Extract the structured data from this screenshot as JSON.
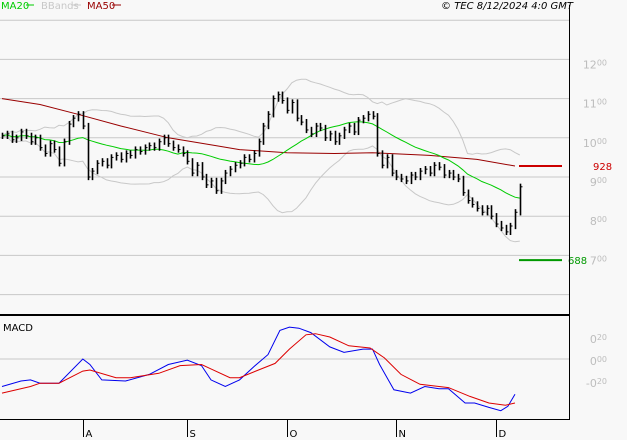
{
  "legend": {
    "ma20": "MA20",
    "bbands": "BBands",
    "ma50": "MA50",
    "copyright": "© TEC 8/12/2024 4:0 GMT"
  },
  "colors": {
    "ma20": "#00cc00",
    "bbands": "#c8c8c8",
    "ma50": "#990000",
    "bars": "#000000",
    "macd": "#0000ee",
    "signal": "#dd0000",
    "resistance": "#cc0000",
    "support": "#009900",
    "grid": "#c8c8c8"
  },
  "chart_data": [
    {
      "type": "ohlc-bar",
      "title": "",
      "ylim": [
        6,
        13
      ],
      "yticks": [
        {
          "value": 12,
          "int": "12",
          "dec": "00"
        },
        {
          "value": 11,
          "int": "11",
          "dec": "00"
        },
        {
          "value": 10,
          "int": "10",
          "dec": "00"
        },
        {
          "value": 9,
          "int": "9",
          "dec": "00"
        },
        {
          "value": 8,
          "int": "8",
          "dec": "00"
        },
        {
          "value": 7,
          "int": "7",
          "dec": "00"
        }
      ],
      "xticks": [
        {
          "index": 17,
          "label": "A"
        },
        {
          "index": 39,
          "label": "S"
        },
        {
          "index": 60,
          "label": "O"
        },
        {
          "index": 83,
          "label": "N"
        },
        {
          "index": 104,
          "label": "D"
        }
      ],
      "bar_pad": 0.08,
      "close": [
        10.05,
        10.1,
        9.95,
        10.0,
        10.15,
        10.05,
        9.9,
        10.0,
        9.75,
        9.6,
        9.85,
        9.7,
        9.35,
        9.9,
        10.35,
        10.5,
        10.6,
        10.3,
        9.0,
        9.15,
        9.35,
        9.4,
        9.3,
        9.5,
        9.55,
        9.45,
        9.6,
        9.55,
        9.7,
        9.65,
        9.75,
        9.8,
        9.75,
        9.9,
        10.0,
        9.85,
        9.75,
        9.7,
        9.6,
        9.4,
        9.1,
        9.3,
        9.0,
        8.8,
        8.9,
        8.65,
        8.9,
        9.1,
        9.2,
        9.3,
        9.35,
        9.5,
        9.45,
        9.6,
        9.9,
        10.3,
        10.6,
        11.0,
        11.1,
        10.95,
        10.7,
        10.9,
        10.5,
        10.4,
        10.2,
        10.1,
        10.3,
        10.25,
        10.0,
        10.1,
        9.9,
        10.05,
        10.2,
        10.3,
        10.15,
        10.45,
        10.5,
        10.6,
        10.55,
        9.6,
        9.3,
        9.5,
        9.1,
        9.0,
        8.95,
        8.9,
        9.05,
        9.0,
        9.15,
        9.2,
        9.1,
        9.3,
        9.25,
        9.05,
        9.1,
        9.0,
        8.95,
        8.6,
        8.4,
        8.3,
        8.2,
        8.1,
        8.2,
        8.0,
        7.8,
        7.7,
        7.6,
        7.75,
        8.1,
        8.75
      ],
      "ma20_period": 20,
      "bb_stddev": 2,
      "ma50_points": [
        [
          0,
          11.0
        ],
        [
          8,
          10.85
        ],
        [
          16,
          10.6
        ],
        [
          25,
          10.3
        ],
        [
          35,
          10.0
        ],
        [
          45,
          9.8
        ],
        [
          50,
          9.7
        ],
        [
          60,
          9.62
        ],
        [
          70,
          9.6
        ],
        [
          78,
          9.62
        ],
        [
          90,
          9.55
        ],
        [
          100,
          9.45
        ],
        [
          108,
          9.28
        ]
      ],
      "levels": [
        {
          "name": "resistance",
          "value": 9.28,
          "label": "928"
        },
        {
          "name": "support",
          "value": 6.88,
          "label": "688"
        }
      ]
    },
    {
      "type": "line",
      "title": "MACD",
      "ylim": [
        -0.55,
        0.4
      ],
      "yticks": [
        {
          "value": 0.2,
          "int": "0",
          "dec": "20"
        },
        {
          "value": 0.0,
          "int": "0",
          "dec": "00"
        },
        {
          "value": -0.2,
          "int": "-0",
          "dec": "20"
        }
      ],
      "series": [
        {
          "name": "MACD",
          "points": [
            [
              0,
              -0.25
            ],
            [
              4,
              -0.2
            ],
            [
              6,
              -0.19
            ],
            [
              8,
              -0.22
            ],
            [
              12,
              -0.22
            ],
            [
              17,
              0.0
            ],
            [
              18.5,
              -0.05
            ],
            [
              21,
              -0.19
            ],
            [
              26,
              -0.2
            ],
            [
              31,
              -0.14
            ],
            [
              35,
              -0.05
            ],
            [
              39,
              -0.01
            ],
            [
              42,
              -0.06
            ],
            [
              44,
              -0.19
            ],
            [
              47,
              -0.25
            ],
            [
              50,
              -0.19
            ],
            [
              53,
              -0.07
            ],
            [
              56,
              0.04
            ],
            [
              58.5,
              0.26
            ],
            [
              60.5,
              0.29
            ],
            [
              62.5,
              0.28
            ],
            [
              65,
              0.24
            ],
            [
              69,
              0.11
            ],
            [
              72,
              0.06
            ],
            [
              76,
              0.09
            ],
            [
              78,
              0.09
            ],
            [
              79.5,
              -0.05
            ],
            [
              82.5,
              -0.28
            ],
            [
              86,
              -0.31
            ],
            [
              89,
              -0.25
            ],
            [
              92,
              -0.27
            ],
            [
              94,
              -0.27
            ],
            [
              97.5,
              -0.4
            ],
            [
              99.5,
              -0.4
            ],
            [
              102.5,
              -0.44
            ],
            [
              105,
              -0.47
            ],
            [
              106.5,
              -0.43
            ],
            [
              108,
              -0.32
            ]
          ]
        },
        {
          "name": "Signal",
          "points": [
            [
              0,
              -0.31
            ],
            [
              6,
              -0.25
            ],
            [
              8,
              -0.22
            ],
            [
              12,
              -0.22
            ],
            [
              17,
              -0.11
            ],
            [
              18.5,
              -0.1
            ],
            [
              24,
              -0.17
            ],
            [
              27,
              -0.17
            ],
            [
              33,
              -0.13
            ],
            [
              37.5,
              -0.06
            ],
            [
              42,
              -0.05
            ],
            [
              44,
              -0.09
            ],
            [
              48,
              -0.17
            ],
            [
              50,
              -0.17
            ],
            [
              54,
              -0.1
            ],
            [
              57.5,
              -0.04
            ],
            [
              60.5,
              0.09
            ],
            [
              64,
              0.22
            ],
            [
              66,
              0.23
            ],
            [
              69,
              0.2
            ],
            [
              73,
              0.12
            ],
            [
              77.5,
              0.1
            ],
            [
              80.5,
              0.01
            ],
            [
              84,
              -0.14
            ],
            [
              88,
              -0.23
            ],
            [
              92,
              -0.25
            ],
            [
              94,
              -0.26
            ],
            [
              98.5,
              -0.34
            ],
            [
              102.5,
              -0.4
            ],
            [
              106,
              -0.42
            ],
            [
              108,
              -0.4
            ]
          ]
        }
      ]
    }
  ]
}
